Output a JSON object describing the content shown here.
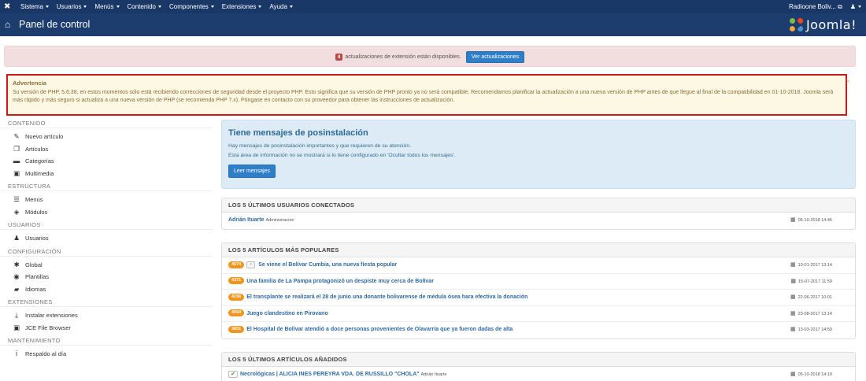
{
  "topbar": {
    "menu": [
      "Sistema",
      "Usuarios",
      "Menús",
      "Contenido",
      "Componentes",
      "Extensiones",
      "Ayuda"
    ],
    "site_link": "Radioone Boliv...",
    "user_menu": "user-icon"
  },
  "titlebar": {
    "title": "Panel de control",
    "brand": "Joomla!"
  },
  "updates": {
    "count": "4",
    "text": "actualizaciones de extensión están disponibles.",
    "button": "Ver actualizaciones"
  },
  "warning": {
    "title": "Advertencia",
    "text": "Su versión de PHP, 5.6.38, en estos momentos sólo está recibiendo correcciones de seguridad desde el proyecto PHP. Esto significa que su versión de PHP pronto ya no será compatible. Recomendamos planificar la actualización a una nueva versión de PHP antes de que llegue al final de la compatibilidad en 01-10-2018. Joomla será más rápido y más seguro si actualiza a una nueva versión de PHP (se recomienda PHP 7.x). Póngase en contacto con su proveedor para obtener las instrucciones de actualización.",
    "close": "×"
  },
  "sidebar": [
    {
      "heading": "CONTENIDO",
      "items": [
        {
          "label": "Nuevo artículo",
          "icon": "pencil-icon",
          "glyph": "✎"
        },
        {
          "label": "Artículos",
          "icon": "copy-icon",
          "glyph": "❐"
        },
        {
          "label": "Categorías",
          "icon": "folder-icon",
          "glyph": "▬"
        },
        {
          "label": "Multimedia",
          "icon": "image-icon",
          "glyph": "▣"
        }
      ]
    },
    {
      "heading": "ESTRUCTURA",
      "items": [
        {
          "label": "Menús",
          "icon": "list-icon",
          "glyph": "☰"
        },
        {
          "label": "Módulos",
          "icon": "cube-icon",
          "glyph": "◈"
        }
      ]
    },
    {
      "heading": "USUARIOS",
      "items": [
        {
          "label": "Usuarios",
          "icon": "users-icon",
          "glyph": "♟"
        }
      ]
    },
    {
      "heading": "CONFIGURACIÓN",
      "items": [
        {
          "label": "Global",
          "icon": "cog-icon",
          "glyph": "✱"
        },
        {
          "label": "Plantillas",
          "icon": "eye-icon",
          "glyph": "◉"
        },
        {
          "label": "Idiomas",
          "icon": "comments-icon",
          "glyph": "▰"
        }
      ]
    },
    {
      "heading": "EXTENSIONES",
      "items": [
        {
          "label": "Instalar extensiones",
          "icon": "upload-icon",
          "glyph": "⤓"
        },
        {
          "label": "JCE File Browser",
          "icon": "picture-icon",
          "glyph": "▣"
        }
      ]
    },
    {
      "heading": "MANTENIMIENTO",
      "items": [
        {
          "label": "Respaldo al día",
          "icon": "info-icon",
          "glyph": "ⅰ"
        }
      ]
    }
  ],
  "postinstall": {
    "title": "Tiene mensajes de posinstalación",
    "line1": "Hay mensajes de posinstalación importantes y que requieren de su atención.",
    "line2": "Esta área de información no se mostrará si lo tiene configurado en 'Ocultar todos los mensajes'.",
    "button": "Leer mensajes"
  },
  "logged_users": {
    "heading": "LOS 5 ÚLTIMOS USUARIOS CONECTADOS",
    "rows": [
      {
        "name": "Adrián Ituarte",
        "sub": "Administración",
        "date": "05-10-2018 14:45"
      }
    ]
  },
  "popular": {
    "heading": "LOS 5 ARTÍCULOS MÁS POPULARES",
    "rows": [
      {
        "hits": "4674",
        "locked": true,
        "title": "Se viene el Bolívar Cumbia, una nueva fiesta popular",
        "date": "10-01-2017 13:14"
      },
      {
        "hits": "4371",
        "locked": false,
        "title": "Una familia de La Pampa protagonizó un despiste muy cerca de Bolívar",
        "date": "15-07-2017 11:59"
      },
      {
        "hits": "4156",
        "locked": false,
        "title": "El transplante se realizará el 28 de junio una donante bolivarense de médula ósea hara efectiva la donación",
        "date": "22-06-2017 10:01"
      },
      {
        "hits": "4064",
        "locked": false,
        "title": "Juego clandestino en Pirovano",
        "date": "23-08-2017 13:14"
      },
      {
        "hits": "3851",
        "locked": false,
        "title": "El Hospital de Bolívar atendió a doce personas provenientes de Olavarría que ya fueron dadas de alta",
        "date": "13-03-2017 14:59"
      }
    ]
  },
  "recent": {
    "heading": "LOS 5 ÚLTIMOS ARTÍCULOS AÑADIDOS",
    "rows": [
      {
        "title": "Necrológicas | ALICIA INES PEREYRA VDA. DE RUSSILLO \"CHOLA\"",
        "author": "Adrián Ituarte",
        "date": "05-10-2018 14:10"
      }
    ]
  }
}
